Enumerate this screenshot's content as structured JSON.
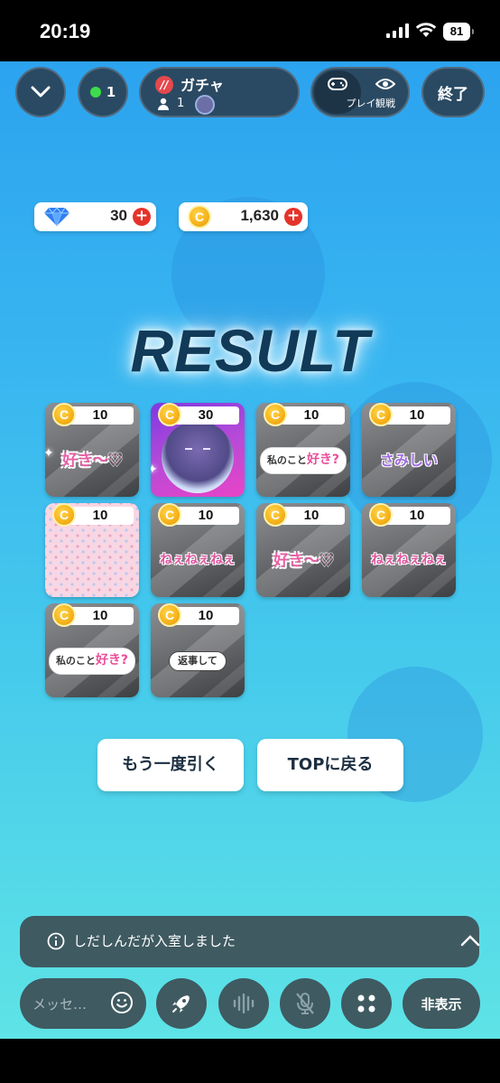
{
  "status_bar": {
    "time": "20:19",
    "battery": "81"
  },
  "header": {
    "online_count": "1",
    "room_name": "ガチャ",
    "room_logo": "//",
    "member_count": "1",
    "mode_play": "プレイ",
    "mode_watch": "観戦",
    "end_label": "終了"
  },
  "currency": {
    "gems": "30",
    "coins": "1,630"
  },
  "result_title": "RESULT",
  "cards": [
    {
      "price": "10",
      "stamp": "好き〜♡",
      "style": "suki"
    },
    {
      "price": "30",
      "stamp": "",
      "style": "rare"
    },
    {
      "price": "10",
      "stamp": "私のこと",
      "stamp2": "好き?",
      "style": "bubble"
    },
    {
      "price": "10",
      "stamp": "さみしい",
      "style": "samishii"
    },
    {
      "price": "10",
      "stamp": "",
      "style": "pattern"
    },
    {
      "price": "10",
      "stamp": "ねぇねぇねぇ",
      "style": "nee"
    },
    {
      "price": "10",
      "stamp": "好き〜♡",
      "style": "suki"
    },
    {
      "price": "10",
      "stamp": "ねぇねぇねぇ",
      "style": "nee"
    },
    {
      "price": "10",
      "stamp": "私のこと",
      "stamp2": "好き?",
      "style": "bubble"
    },
    {
      "price": "10",
      "stamp": "返事して",
      "style": "reply"
    }
  ],
  "actions": {
    "again": "もう一度引く",
    "top": "TOPに戻る"
  },
  "toast": {
    "message": "しだしんだが入室しました"
  },
  "bottom": {
    "message_placeholder": "メッセ…",
    "hide_label": "非表示"
  },
  "icons": [
    "chevron-down-icon",
    "person-icon",
    "gamepad-icon",
    "eye-icon",
    "gem-icon",
    "coin-icon",
    "plus-icon",
    "info-icon",
    "chevron-up-icon",
    "emoji-icon",
    "rocket-icon",
    "voice-icon",
    "mic-off-icon",
    "grid-icon"
  ],
  "colors": {
    "panel": "#2a4a63",
    "accent_red": "#e5332a",
    "title": "#103a58",
    "online": "#3ddc4a"
  }
}
